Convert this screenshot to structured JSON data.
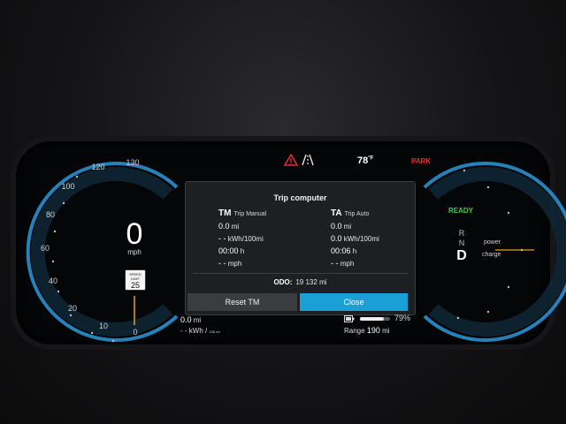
{
  "speedometer": {
    "ticks": [
      "130",
      "120",
      "100",
      "80",
      "60",
      "40",
      "20",
      "10",
      "0"
    ],
    "speed_value": "0",
    "speed_unit": "mph",
    "speed_limit_label": "SPEED LIMIT",
    "speed_limit_value": "25"
  },
  "status_bar": {
    "warning_icon": "warning-triangle-icon",
    "lane_icon": "road-lane-icon",
    "temperature": "78",
    "temperature_unit": "°F",
    "park": "PARK",
    "park_color": "#e03030"
  },
  "trip_computer": {
    "title": "Trip computer",
    "manual": {
      "abbr": "TM",
      "name": "Trip Manual",
      "distance": "0.0",
      "distance_unit": "mi",
      "consumption": "- -",
      "consumption_unit": "kWh/100mi",
      "time": "00:00",
      "time_unit": "h",
      "avg_speed": "- -",
      "avg_speed_unit": "mph"
    },
    "auto": {
      "abbr": "TA",
      "name": "Trip Auto",
      "distance": "0.0",
      "distance_unit": "mi",
      "consumption": "0.0",
      "consumption_unit": "kWh/100mi",
      "time": "00:06",
      "time_unit": "h",
      "avg_speed": "- -",
      "avg_speed_unit": "mph"
    },
    "odo_label": "ODO:",
    "odo_value": "19 132",
    "odo_unit": "mi",
    "reset_button": "Reset TM",
    "close_button": "Close",
    "accent_color": "#1aa0d4"
  },
  "right_gauge": {
    "ready": "READY",
    "ready_color": "#3bd13b",
    "gears": [
      "R",
      "N",
      "D"
    ],
    "active_gear": "D",
    "power_label": "power",
    "charge_label": "charge"
  },
  "bottom": {
    "trip_distance": "0.0",
    "trip_distance_unit": "mi",
    "consumption": "- -",
    "consumption_unit": "kWh /",
    "consumption_unit_small": "100 mi",
    "battery_percent": "79",
    "battery_percent_unit": "%",
    "battery_level": 0.79,
    "range_label": "Range",
    "range_value": "190",
    "range_unit": "mi"
  }
}
